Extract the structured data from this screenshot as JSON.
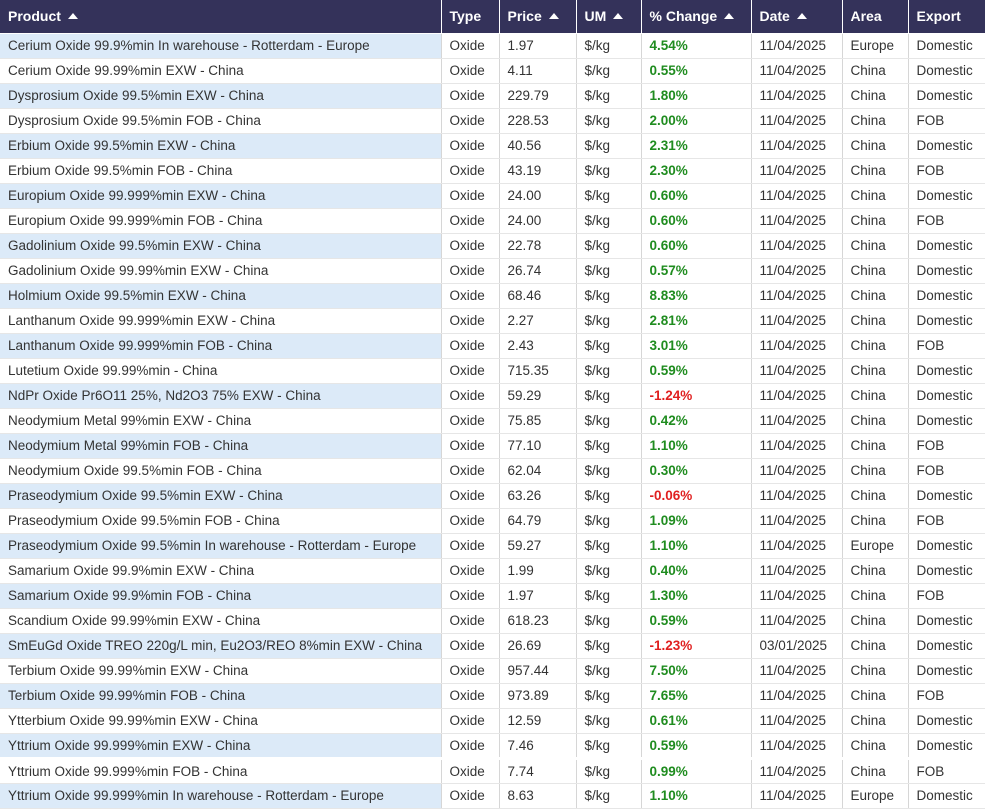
{
  "columns": [
    {
      "label": "Product",
      "sort": true
    },
    {
      "label": "Type",
      "sort": false
    },
    {
      "label": "Price",
      "sort": true
    },
    {
      "label": "UM",
      "sort": true
    },
    {
      "label": "% Change",
      "sort": true
    },
    {
      "label": "Date",
      "sort": true
    },
    {
      "label": "Area",
      "sort": false
    },
    {
      "label": "Export",
      "sort": false
    }
  ],
  "rows": [
    {
      "product": "Cerium Oxide 99.9%min In warehouse - Rotterdam - Europe",
      "type": "Oxide",
      "price": "1.97",
      "um": "$/kg",
      "change": "4.54%",
      "date": "11/04/2025",
      "area": "Europe",
      "export": "Domestic"
    },
    {
      "product": "Cerium Oxide 99.99%min EXW - China",
      "type": "Oxide",
      "price": "4.11",
      "um": "$/kg",
      "change": "0.55%",
      "date": "11/04/2025",
      "area": "China",
      "export": "Domestic"
    },
    {
      "product": "Dysprosium Oxide 99.5%min EXW - China",
      "type": "Oxide",
      "price": "229.79",
      "um": "$/kg",
      "change": "1.80%",
      "date": "11/04/2025",
      "area": "China",
      "export": "Domestic"
    },
    {
      "product": "Dysprosium Oxide 99.5%min FOB - China",
      "type": "Oxide",
      "price": "228.53",
      "um": "$/kg",
      "change": "2.00%",
      "date": "11/04/2025",
      "area": "China",
      "export": "FOB"
    },
    {
      "product": "Erbium Oxide 99.5%min EXW - China",
      "type": "Oxide",
      "price": "40.56",
      "um": "$/kg",
      "change": "2.31%",
      "date": "11/04/2025",
      "area": "China",
      "export": "Domestic"
    },
    {
      "product": "Erbium Oxide 99.5%min FOB - China",
      "type": "Oxide",
      "price": "43.19",
      "um": "$/kg",
      "change": "2.30%",
      "date": "11/04/2025",
      "area": "China",
      "export": "FOB"
    },
    {
      "product": "Europium Oxide 99.999%min EXW - China",
      "type": "Oxide",
      "price": "24.00",
      "um": "$/kg",
      "change": "0.60%",
      "date": "11/04/2025",
      "area": "China",
      "export": "Domestic"
    },
    {
      "product": "Europium Oxide 99.999%min FOB - China",
      "type": "Oxide",
      "price": "24.00",
      "um": "$/kg",
      "change": "0.60%",
      "date": "11/04/2025",
      "area": "China",
      "export": "FOB"
    },
    {
      "product": "Gadolinium Oxide 99.5%min EXW - China",
      "type": "Oxide",
      "price": "22.78",
      "um": "$/kg",
      "change": "0.60%",
      "date": "11/04/2025",
      "area": "China",
      "export": "Domestic"
    },
    {
      "product": "Gadolinium Oxide 99.99%min EXW - China",
      "type": "Oxide",
      "price": "26.74",
      "um": "$/kg",
      "change": "0.57%",
      "date": "11/04/2025",
      "area": "China",
      "export": "Domestic"
    },
    {
      "product": "Holmium Oxide 99.5%min EXW - China",
      "type": "Oxide",
      "price": "68.46",
      "um": "$/kg",
      "change": "8.83%",
      "date": "11/04/2025",
      "area": "China",
      "export": "Domestic"
    },
    {
      "product": "Lanthanum Oxide 99.999%min EXW - China",
      "type": "Oxide",
      "price": "2.27",
      "um": "$/kg",
      "change": "2.81%",
      "date": "11/04/2025",
      "area": "China",
      "export": "Domestic"
    },
    {
      "product": "Lanthanum Oxide 99.999%min FOB - China",
      "type": "Oxide",
      "price": "2.43",
      "um": "$/kg",
      "change": "3.01%",
      "date": "11/04/2025",
      "area": "China",
      "export": "FOB"
    },
    {
      "product": "Lutetium Oxide 99.99%min - China",
      "type": "Oxide",
      "price": "715.35",
      "um": "$/kg",
      "change": "0.59%",
      "date": "11/04/2025",
      "area": "China",
      "export": "Domestic"
    },
    {
      "product": "NdPr Oxide Pr6O11 25%, Nd2O3 75% EXW - China",
      "type": "Oxide",
      "price": "59.29",
      "um": "$/kg",
      "change": "-1.24%",
      "date": "11/04/2025",
      "area": "China",
      "export": "Domestic"
    },
    {
      "product": "Neodymium Metal 99%min EXW - China",
      "type": "Oxide",
      "price": "75.85",
      "um": "$/kg",
      "change": "0.42%",
      "date": "11/04/2025",
      "area": "China",
      "export": "Domestic"
    },
    {
      "product": "Neodymium Metal 99%min FOB - China",
      "type": "Oxide",
      "price": "77.10",
      "um": "$/kg",
      "change": "1.10%",
      "date": "11/04/2025",
      "area": "China",
      "export": "FOB"
    },
    {
      "product": "Neodymium Oxide 99.5%min FOB - China",
      "type": "Oxide",
      "price": "62.04",
      "um": "$/kg",
      "change": "0.30%",
      "date": "11/04/2025",
      "area": "China",
      "export": "FOB"
    },
    {
      "product": "Praseodymium Oxide 99.5%min EXW - China",
      "type": "Oxide",
      "price": "63.26",
      "um": "$/kg",
      "change": "-0.06%",
      "date": "11/04/2025",
      "area": "China",
      "export": "Domestic"
    },
    {
      "product": "Praseodymium Oxide 99.5%min FOB - China",
      "type": "Oxide",
      "price": "64.79",
      "um": "$/kg",
      "change": "1.09%",
      "date": "11/04/2025",
      "area": "China",
      "export": "FOB"
    },
    {
      "product": "Praseodymium Oxide 99.5%min In warehouse - Rotterdam - Europe",
      "type": "Oxide",
      "price": "59.27",
      "um": "$/kg",
      "change": "1.10%",
      "date": "11/04/2025",
      "area": "Europe",
      "export": "Domestic"
    },
    {
      "product": "Samarium Oxide 99.9%min EXW - China",
      "type": "Oxide",
      "price": "1.99",
      "um": "$/kg",
      "change": "0.40%",
      "date": "11/04/2025",
      "area": "China",
      "export": "Domestic"
    },
    {
      "product": "Samarium Oxide 99.9%min FOB - China",
      "type": "Oxide",
      "price": "1.97",
      "um": "$/kg",
      "change": "1.30%",
      "date": "11/04/2025",
      "area": "China",
      "export": "FOB"
    },
    {
      "product": "Scandium Oxide 99.99%min EXW - China",
      "type": "Oxide",
      "price": "618.23",
      "um": "$/kg",
      "change": "0.59%",
      "date": "11/04/2025",
      "area": "China",
      "export": "Domestic"
    },
    {
      "product": "SmEuGd Oxide TREO 220g/L min, Eu2O3/REO 8%min EXW - China",
      "type": "Oxide",
      "price": "26.69",
      "um": "$/kg",
      "change": "-1.23%",
      "date": "03/01/2025",
      "area": "China",
      "export": "Domestic"
    },
    {
      "product": "Terbium Oxide 99.99%min EXW - China",
      "type": "Oxide",
      "price": "957.44",
      "um": "$/kg",
      "change": "7.50%",
      "date": "11/04/2025",
      "area": "China",
      "export": "Domestic"
    },
    {
      "product": "Terbium Oxide 99.99%min FOB - China",
      "type": "Oxide",
      "price": "973.89",
      "um": "$/kg",
      "change": "7.65%",
      "date": "11/04/2025",
      "area": "China",
      "export": "FOB"
    },
    {
      "product": "Ytterbium Oxide 99.99%min EXW - China",
      "type": "Oxide",
      "price": "12.59",
      "um": "$/kg",
      "change": "0.61%",
      "date": "11/04/2025",
      "area": "China",
      "export": "Domestic"
    },
    {
      "product": "Yttrium Oxide 99.999%min EXW - China",
      "type": "Oxide",
      "price": "7.46",
      "um": "$/kg",
      "change": "0.59%",
      "date": "11/04/2025",
      "area": "China",
      "export": "Domestic"
    },
    {
      "product": "Yttrium Oxide 99.999%min FOB - China",
      "type": "Oxide",
      "price": "7.74",
      "um": "$/kg",
      "change": "0.99%",
      "date": "11/04/2025",
      "area": "China",
      "export": "FOB"
    },
    {
      "product": "Yttrium Oxide 99.999%min In warehouse - Rotterdam - Europe",
      "type": "Oxide",
      "price": "8.63",
      "um": "$/kg",
      "change": "1.10%",
      "date": "11/04/2025",
      "area": "Europe",
      "export": "Domestic"
    }
  ],
  "colors": {
    "header_bg": "#34325a",
    "row_highlight": "#dceaf8",
    "positive": "#1f8c1f",
    "negative": "#e02020"
  }
}
